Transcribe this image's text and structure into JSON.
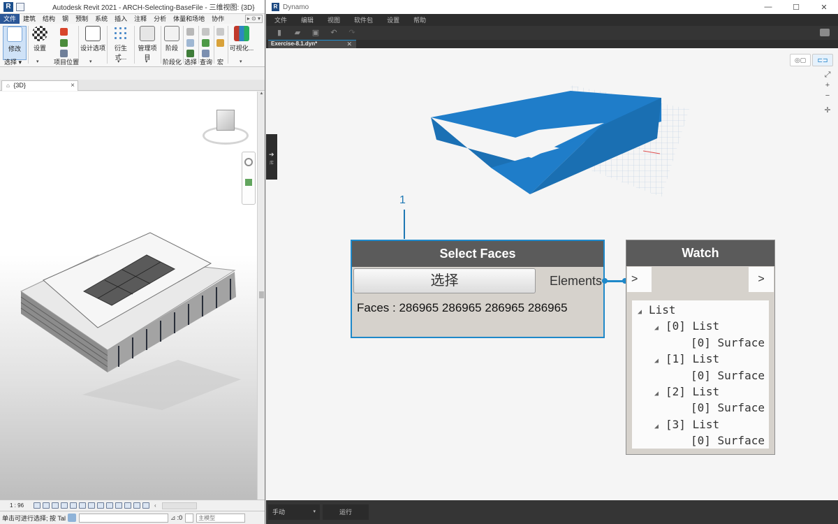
{
  "revit": {
    "title": "Autodesk Revit 2021 - ARCH-Selecting-BaseFile - 三维视图: {3D}",
    "logo": "R",
    "menu": [
      "文件",
      "建筑",
      "结构",
      "钢",
      "预制",
      "系统",
      "插入",
      "注释",
      "分析",
      "体量和场地",
      "协作"
    ],
    "menu_more": "▸ ⊙ ▾",
    "ribbon": {
      "modify": "修改",
      "settings": "设置",
      "design_options": "设计选项",
      "derived": "衍生式...",
      "manage_project": "管理项目",
      "phase": "阶段",
      "visualize": "可视化...",
      "groups": {
        "select": "选择 ▾",
        "project_location": "项目位置",
        "phasing": "阶段化",
        "selection": "选择",
        "inquiry": "查询",
        "macro": "宏"
      }
    },
    "view_tab": "{3D}",
    "view_tab_close": "×",
    "scale": "1 : 96",
    "status_text": "单击可进行选择; 按 Tal",
    "status_zero": ":0",
    "status_model": "主模型"
  },
  "dynamo": {
    "title": "Dynamo",
    "logo": "R",
    "window_buttons": [
      "—",
      "☐",
      "✕"
    ],
    "menu": [
      "文件",
      "编辑",
      "视图",
      "软件包",
      "设置",
      "帮助"
    ],
    "file_tab": "Exercise-8.1.dyn*",
    "file_tab_close": "✕",
    "library_arrow": "➔",
    "library_label": "库",
    "run_mode": "手动",
    "run_mode_caret": "▾",
    "run_button": "运行",
    "zoom": [
      "⤢",
      "+",
      "−",
      "✛"
    ],
    "annotation_number": "1",
    "select_node": {
      "title": "Select Faces",
      "button": "选择",
      "port": "Elements",
      "output": "Faces : 286965 286965 286965 286965"
    },
    "watch_node": {
      "title": "Watch",
      "in_port": ">",
      "out_port": ">",
      "tree": [
        {
          "indent": 0,
          "text": "List"
        },
        {
          "indent": 1,
          "text": "[0] List"
        },
        {
          "indent": 2,
          "text": "[0] Surface"
        },
        {
          "indent": 1,
          "text": "[1] List"
        },
        {
          "indent": 2,
          "text": "[0] Surface"
        },
        {
          "indent": 1,
          "text": "[2] List"
        },
        {
          "indent": 2,
          "text": "[0] Surface"
        },
        {
          "indent": 1,
          "text": "[3] List"
        },
        {
          "indent": 2,
          "text": "[0] Surface"
        }
      ]
    }
  },
  "colors": {
    "dynamo_accent": "#1e88c9",
    "node_header": "#5b5b5b",
    "node_body": "#d6d2cc",
    "geometry_blue": "#1f7dc9",
    "revit_blue": "#2b5797"
  }
}
